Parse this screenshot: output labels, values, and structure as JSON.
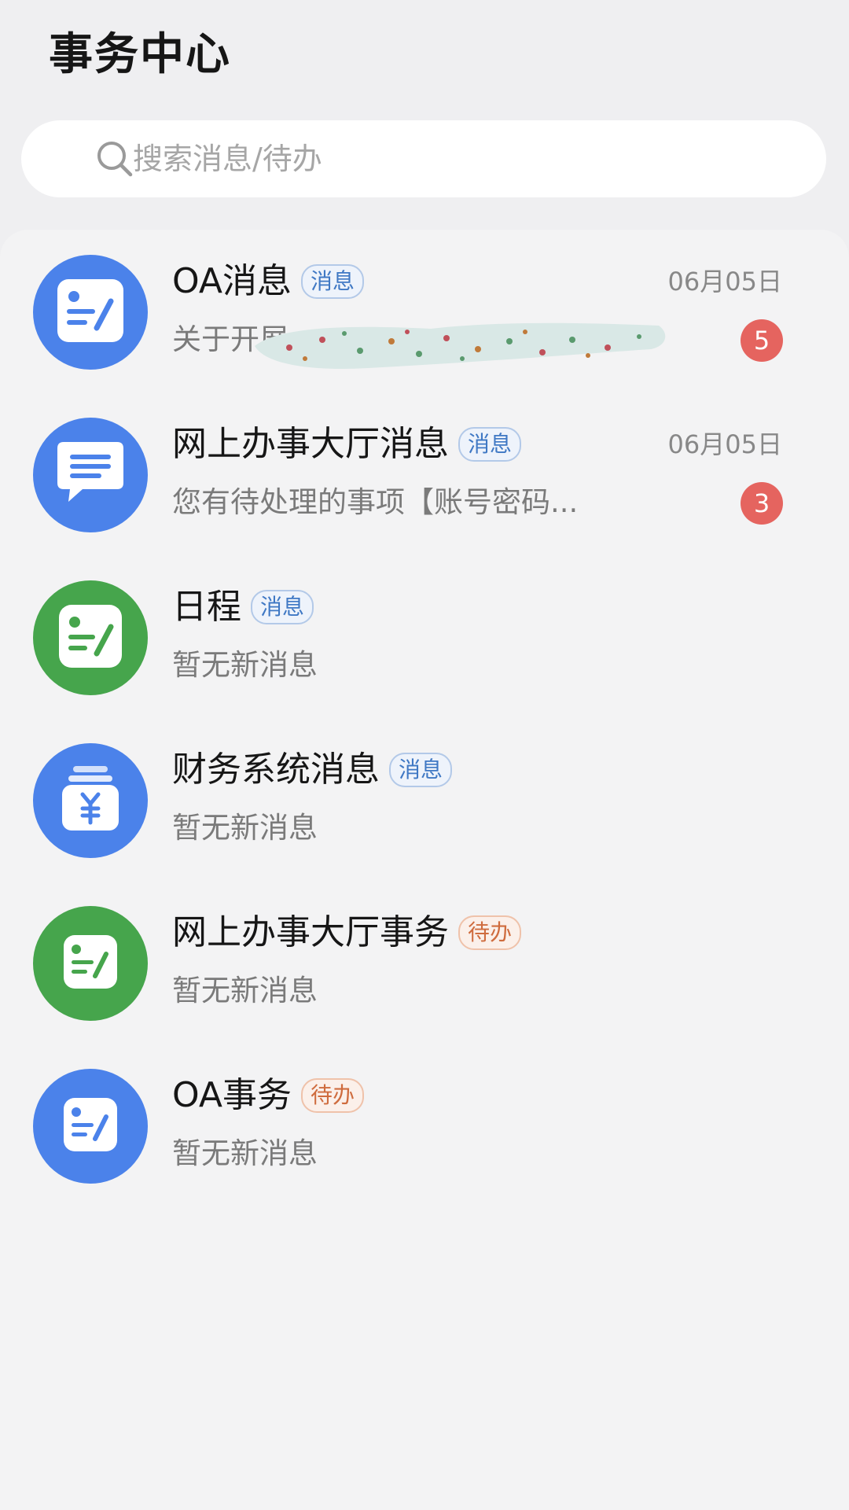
{
  "header": {
    "title": "事务中心"
  },
  "search": {
    "placeholder": "搜索消息/待办"
  },
  "items": [
    {
      "title": "OA消息",
      "tag": "消息",
      "subtitle": "关于开展",
      "date": "06月05日",
      "badge": "5",
      "icon": "document-edit-icon",
      "color": "#4b82ea"
    },
    {
      "title": "网上办事大厅消息",
      "tag": "消息",
      "subtitle": "您有待处理的事项【账号密码...",
      "date": "06月05日",
      "badge": "3",
      "icon": "chat-bubble-icon",
      "color": "#4b82ea"
    },
    {
      "title": "日程",
      "tag": "消息",
      "subtitle": "暂无新消息",
      "icon": "document-edit-icon",
      "color": "#46a54c"
    },
    {
      "title": "财务系统消息",
      "tag": "消息",
      "subtitle": "暂无新消息",
      "icon": "yuan-jar-icon",
      "color": "#4b82ea"
    },
    {
      "title": "网上办事大厅事务",
      "tag": "待办",
      "subtitle": "暂无新消息",
      "icon": "document-edit-icon",
      "color": "#46a54c"
    },
    {
      "title": "OA事务",
      "tag": "待办",
      "subtitle": "暂无新消息",
      "icon": "document-edit-icon",
      "color": "#4b82ea"
    }
  ],
  "colors": {
    "background": "#efeff1",
    "badge": "#e5645f",
    "tag_message": "#3f78c4",
    "tag_todo": "#cf6c3e"
  }
}
